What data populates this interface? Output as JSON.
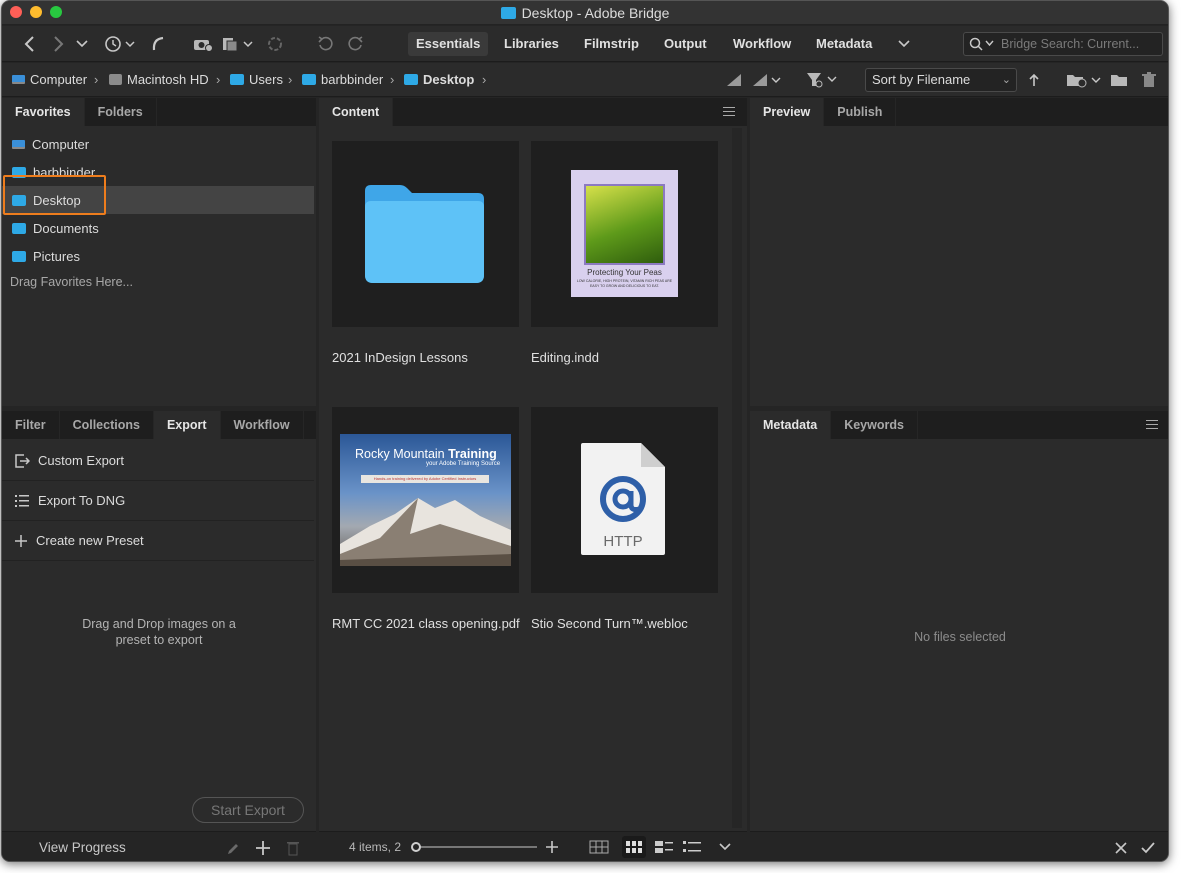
{
  "window": {
    "title": "Desktop - Adobe Bridge"
  },
  "toolbar": {
    "workspaces": [
      "Essentials",
      "Libraries",
      "Filmstrip",
      "Output",
      "Workflow",
      "Metadata"
    ],
    "search_placeholder": "Bridge Search: Current..."
  },
  "path": {
    "crumbs": [
      "Computer",
      "Macintosh HD",
      "Users",
      "barbbinder",
      "Desktop"
    ],
    "sort_label": "Sort by Filename"
  },
  "favorites_panel": {
    "tabs": [
      "Favorites",
      "Folders"
    ],
    "items": [
      "Computer",
      "barbbinder",
      "Desktop",
      "Documents",
      "Pictures"
    ],
    "hint": "Drag Favorites Here..."
  },
  "export_panel": {
    "tabs": [
      "Filter",
      "Collections",
      "Export",
      "Workflow"
    ],
    "rows": [
      "Custom Export",
      "Export To DNG",
      "Create new Preset"
    ],
    "drop_hint_line1": "Drag and Drop images on a",
    "drop_hint_line2": "preset to export",
    "start_export": "Start Export",
    "view_progress": "View Progress"
  },
  "content_panel": {
    "tab": "Content",
    "items": [
      {
        "name": "2021 InDesign Lessons",
        "kind": "folder"
      },
      {
        "name": "Editing.indd",
        "kind": "indd",
        "thumb_title": "Protecting Your Peas",
        "thumb_sub1": "LOW CALORIE, HIGH PROTEIN, VITAMIN RICH PEAS ARE",
        "thumb_sub2": "EASY TO GROW AND DELICIOUS TO EAT."
      },
      {
        "name": "RMT CC 2021 class opening.pdf",
        "kind": "pdf",
        "thumb_title_a": "Rocky Mountain ",
        "thumb_title_b": "Training",
        "thumb_sub": "your Adobe Training Source",
        "thumb_banner": "Hands-on training delivered by Adobe Certified Instructors"
      },
      {
        "name": "Stio Second Turn™.webloc",
        "kind": "webloc",
        "thumb_label": "HTTP"
      }
    ],
    "status": "4 items, 2"
  },
  "preview_panel": {
    "tabs": [
      "Preview",
      "Publish"
    ]
  },
  "metadata_panel": {
    "tabs": [
      "Metadata",
      "Keywords"
    ],
    "empty": "No files selected"
  },
  "colors": {
    "accent_folder": "#2ea9e6",
    "highlight": "#ee7d1d"
  }
}
